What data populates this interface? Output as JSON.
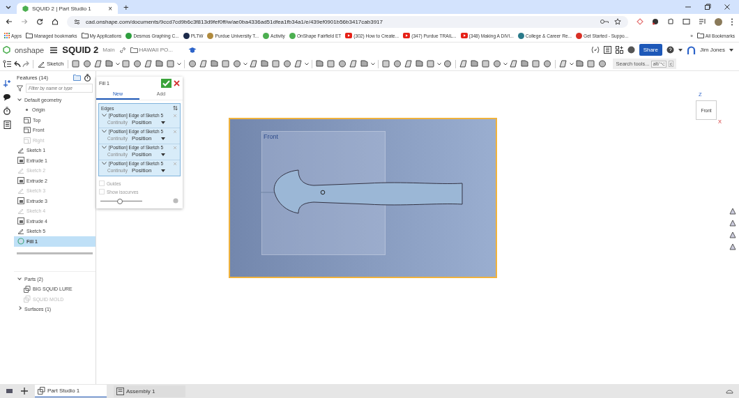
{
  "browser": {
    "tab": {
      "title": "SQUID 2 | Part Studio 1",
      "close": "×"
    },
    "new_tab": "+",
    "url": "cad.onshape.com/documents/9ccd7cd9b6c3f813d9fef0ff/w/ae0ba4336ad51dfea1fb34a1/e/439ef0901b56b3417cab3917",
    "bookmarks": [
      {
        "label": "Apps",
        "kind": "apps"
      },
      {
        "label": "Managed bookmarks",
        "kind": "folder"
      },
      {
        "label": "My Applications",
        "kind": "folder"
      },
      {
        "label": "Desmos Graphing C...",
        "kind": "site",
        "color": "#2e9e3e"
      },
      {
        "label": "PLTW",
        "kind": "site",
        "color": "#1c2a4a"
      },
      {
        "label": "Purdue University T...",
        "kind": "site",
        "color": "#b08a3c"
      },
      {
        "label": "Activity",
        "kind": "site",
        "color": "#4caf50"
      },
      {
        "label": "OnShape Fairfield ET",
        "kind": "site",
        "color": "#4caf50"
      },
      {
        "label": "(302) How to Create...",
        "kind": "video",
        "color": "#e62117"
      },
      {
        "label": "(347) Purdue TRAIL...",
        "kind": "video",
        "color": "#e62117"
      },
      {
        "label": "(348) Making A DIVI...",
        "kind": "video",
        "color": "#e62117"
      },
      {
        "label": "College & Career Re...",
        "kind": "site",
        "color": "#2a7a8a"
      },
      {
        "label": "Get Started - Suppo...",
        "kind": "site",
        "color": "#d93025"
      }
    ],
    "more": "»",
    "all_bookmarks": "All Bookmarks"
  },
  "app": {
    "logo": "onshape",
    "document": "SQUID 2",
    "branch": "Main",
    "folder": "HAWAII PO...",
    "share": "Share",
    "user": "Jim Jones"
  },
  "toolbar": {
    "sketch": "Sketch",
    "search": {
      "placeholder": "Search tools...",
      "keys": [
        "alt/⌥",
        "c"
      ]
    }
  },
  "features": {
    "title": "Features (14)",
    "filter": {
      "placeholder": "Filter by name or type"
    },
    "default_geometry": {
      "label": "Default geometry",
      "expanded": true,
      "children": [
        {
          "label": "Origin",
          "kind": "point",
          "dimmed": false
        },
        {
          "label": "Top",
          "kind": "plane",
          "dimmed": false
        },
        {
          "label": "Front",
          "kind": "plane",
          "dimmed": false
        },
        {
          "label": "Right",
          "kind": "plane",
          "dimmed": true
        }
      ]
    },
    "items": [
      {
        "label": "Sketch 1",
        "kind": "sketch",
        "dimmed": false,
        "selected": false
      },
      {
        "label": "Extrude 1",
        "kind": "extrude",
        "dimmed": false,
        "selected": false
      },
      {
        "label": "Sketch 2",
        "kind": "sketch",
        "dimmed": true,
        "selected": false
      },
      {
        "label": "Extrude 2",
        "kind": "extrude",
        "dimmed": false,
        "selected": false
      },
      {
        "label": "Sketch 3",
        "kind": "sketch",
        "dimmed": true,
        "selected": false
      },
      {
        "label": "Extrude 3",
        "kind": "extrude",
        "dimmed": false,
        "selected": false
      },
      {
        "label": "Sketch 4",
        "kind": "sketch",
        "dimmed": true,
        "selected": false
      },
      {
        "label": "Extrude 4",
        "kind": "extrude",
        "dimmed": false,
        "selected": false
      },
      {
        "label": "Sketch 5",
        "kind": "sketch",
        "dimmed": false,
        "selected": false
      },
      {
        "label": "Fill 1",
        "kind": "fill",
        "dimmed": false,
        "selected": true
      }
    ]
  },
  "parts": {
    "label": "Parts (2)",
    "expanded": true,
    "children": [
      {
        "label": "BIG SQUID LURE",
        "dimmed": false
      },
      {
        "label": "SQUID MOLD",
        "dimmed": true
      }
    ]
  },
  "surfaces": {
    "label": "Surfaces (1)",
    "expanded": false
  },
  "dialog": {
    "title": "Fill 1",
    "tabs": [
      {
        "label": "New",
        "selected": true
      },
      {
        "label": "Add",
        "selected": false
      }
    ],
    "edges_label": "Edges",
    "edges": [
      {
        "label": "[Position] Edge of Sketch 5",
        "field": "Continuity",
        "value": "Position"
      },
      {
        "label": "[Position] Edge of Sketch 5",
        "field": "Continuity",
        "value": "Position"
      },
      {
        "label": "[Position] Edge of Sketch 5",
        "field": "Continuity",
        "value": "Position"
      },
      {
        "label": "[Position] Edge of Sketch 5",
        "field": "Continuity",
        "value": "Position"
      }
    ],
    "options": [
      {
        "label": "Guides",
        "checked": false
      },
      {
        "label": "Show isocurves",
        "checked": false
      }
    ],
    "slider": {
      "level": 0.45
    }
  },
  "viewport": {
    "plane_label": "Front",
    "view_cube": {
      "face": "Front",
      "z": "Z",
      "x": "X"
    }
  },
  "bottom_tabs": [
    {
      "label": "Part Studio 1",
      "selected": true,
      "kind": "partstudio"
    },
    {
      "label": "Assembly 1",
      "selected": false,
      "kind": "assembly"
    }
  ]
}
